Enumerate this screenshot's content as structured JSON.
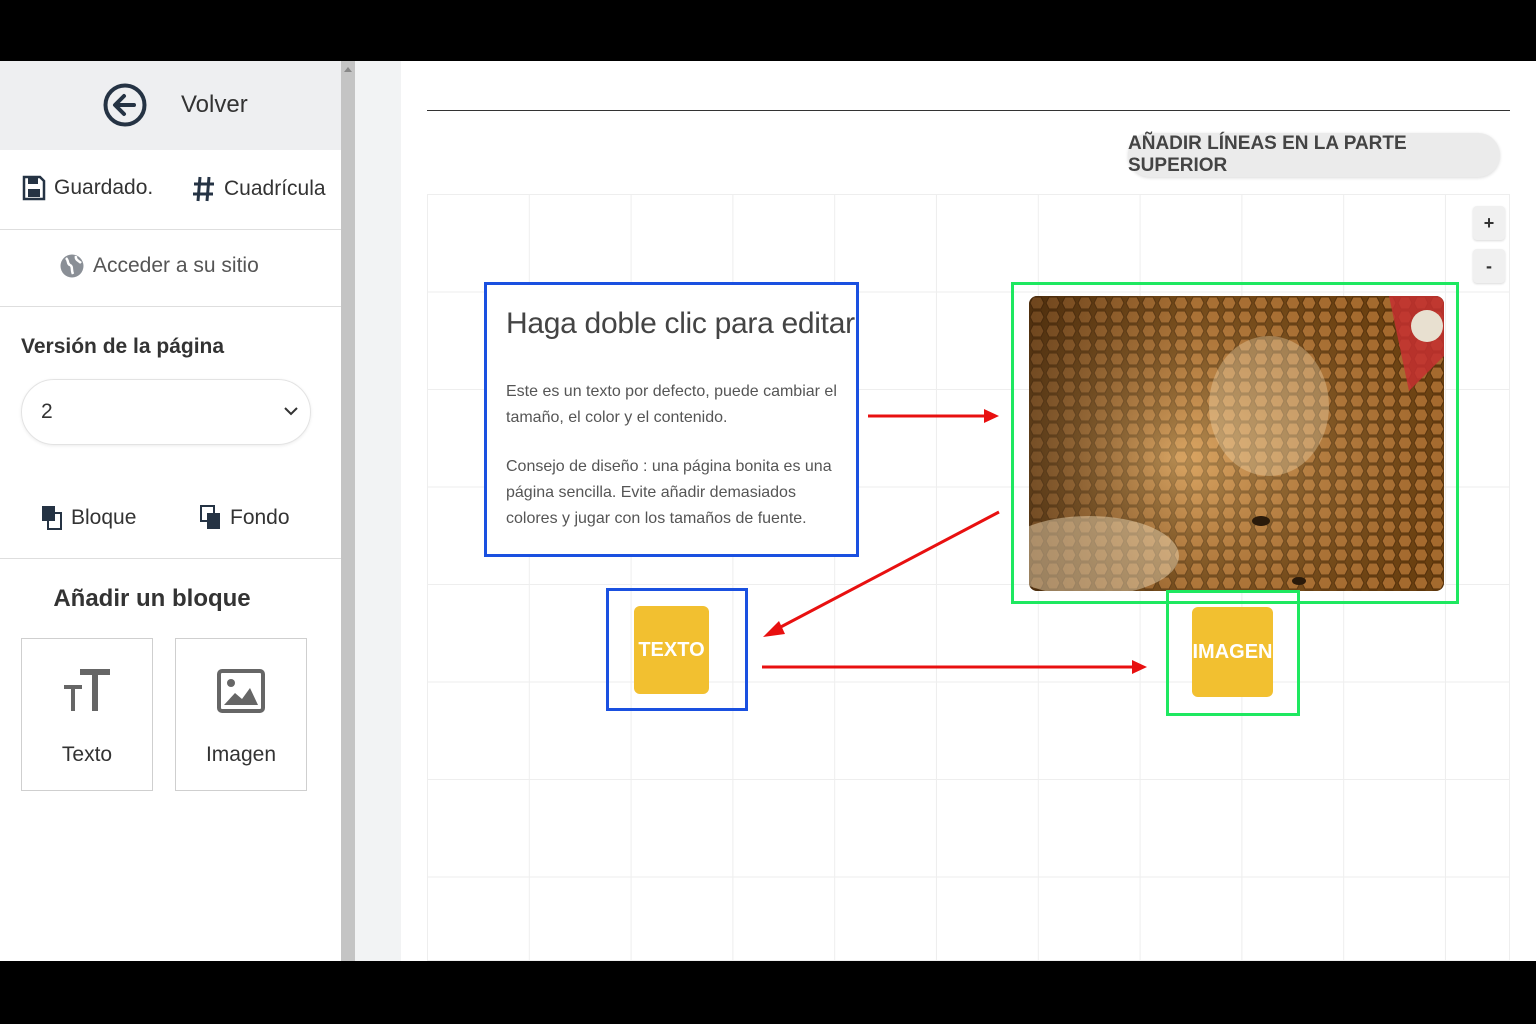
{
  "sidebar": {
    "back_label": "Volver",
    "saved_label": "Guardado.",
    "grid_label": "Cuadrícula",
    "access_label": "Acceder a su sitio",
    "version_label": "Versión de la página",
    "version_value": "2",
    "block_label": "Bloque",
    "background_label": "Fondo",
    "add_block_title": "Añadir un bloque",
    "tiles": [
      {
        "label": "Texto",
        "icon": "text-icon"
      },
      {
        "label": "Imagen",
        "icon": "image-icon"
      }
    ]
  },
  "canvas": {
    "add_lines_button": "AÑADIR LÍNEAS EN LA PARTE SUPERIOR",
    "zoom_in": "+",
    "zoom_out": "-",
    "text_block": {
      "title": "Haga doble clic para editar",
      "paragraph1": "Este es un texto por defecto, puede cambiar el tamaño, el color y el contenido.",
      "paragraph2": "Consejo de diseño : una página bonita es una página sencilla. Evite añadir demasiados colores y jugar con los tamaños de fuente."
    },
    "image_block": {
      "description": "honeycomb photo"
    },
    "texto_button": "TEXTO",
    "imagen_button": "IMAGEN"
  },
  "colors": {
    "text_highlight": "#1a50e0",
    "image_highlight": "#1ee860",
    "arrow": "#e81010",
    "button_yellow": "#f2c030"
  }
}
